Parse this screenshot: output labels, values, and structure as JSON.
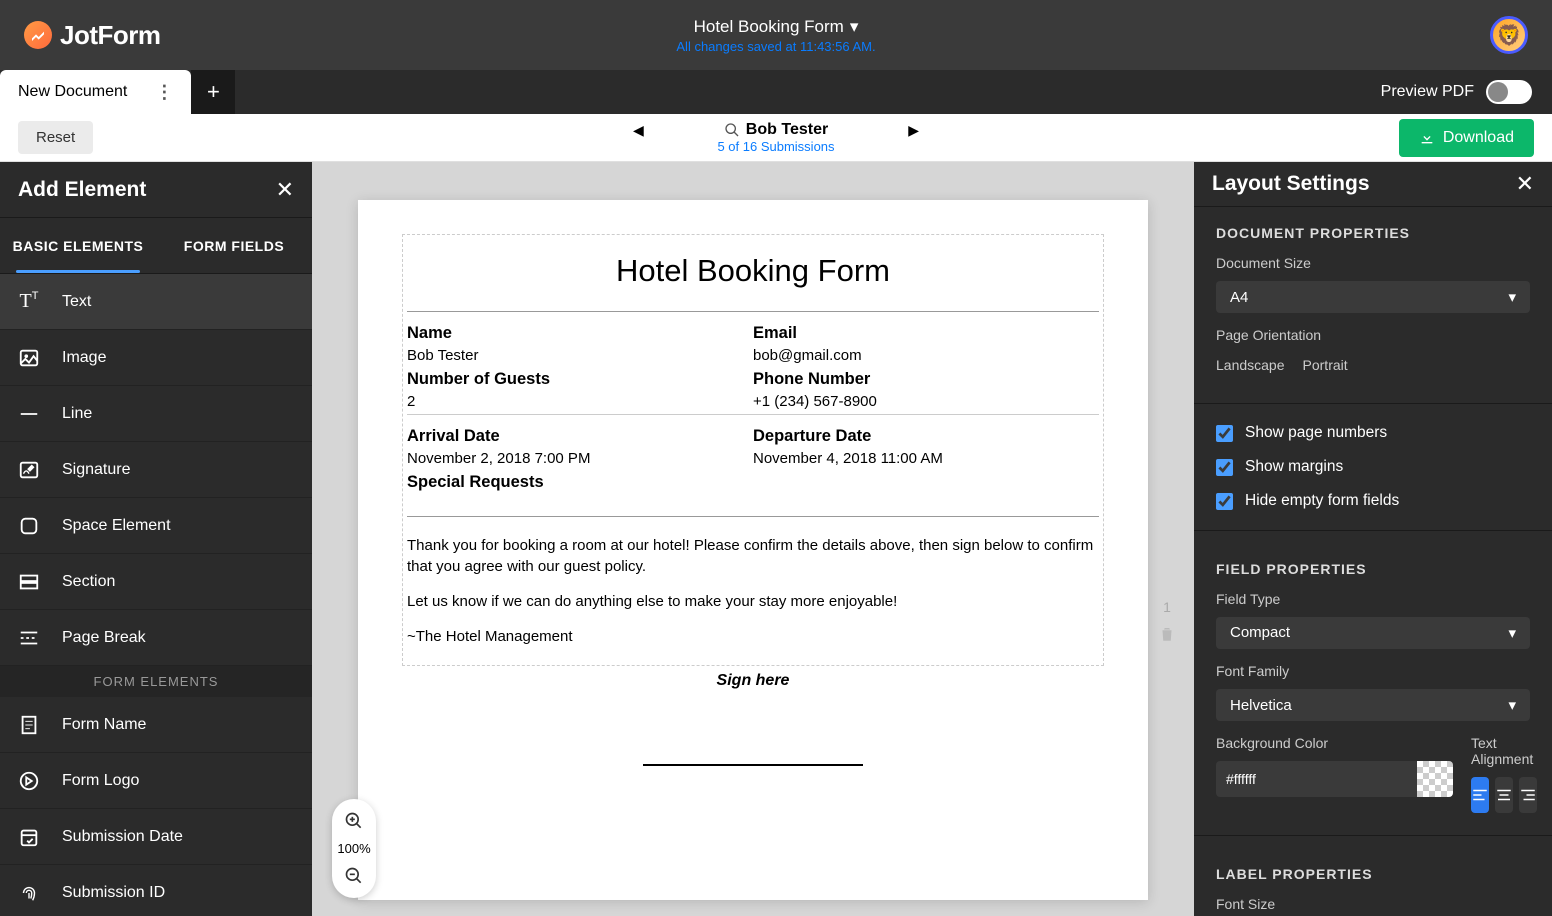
{
  "header": {
    "brand": "JotForm",
    "form_title": "Hotel Booking Form",
    "saved_status": "All changes saved at 11:43:56 AM."
  },
  "secondbar": {
    "tab_label": "New Document",
    "preview_label": "Preview PDF"
  },
  "thirdbar": {
    "reset": "Reset",
    "tester_name": "Bob Tester",
    "submission_count": "5 of 16 Submissions",
    "download": "Download"
  },
  "left_panel": {
    "title": "Add Element",
    "tabs": [
      "BASIC ELEMENTS",
      "FORM FIELDS"
    ],
    "items": [
      "Text",
      "Image",
      "Line",
      "Signature",
      "Space Element",
      "Section",
      "Page Break"
    ],
    "divider": "FORM ELEMENTS",
    "form_items": [
      "Form Name",
      "Form Logo",
      "Submission Date",
      "Submission ID"
    ]
  },
  "document": {
    "title": "Hotel Booking Form",
    "fields": {
      "name_label": "Name",
      "name": "Bob Tester",
      "email_label": "Email",
      "email": "bob@gmail.com",
      "guests_label": "Number of Guests",
      "guests": "2",
      "phone_label": "Phone Number",
      "phone": "+1 (234) 567-8900",
      "arrival_label": "Arrival Date",
      "arrival": "November 2, 2018 7:00 PM",
      "departure_label": "Departure Date",
      "departure": "November 4, 2018 11:00 AM",
      "special_label": "Special Requests"
    },
    "message_p1": "Thank you for booking a room at our hotel! Please confirm the details above, then sign below to confirm that you agree with our guest policy.",
    "message_p2": "Let us know if we can do anything else to make your stay more enjoyable!",
    "message_sig": "~The Hotel Management",
    "sign_here": "Sign here"
  },
  "page_number": "1",
  "zoom": "100%",
  "right_panel": {
    "title": "Layout Settings",
    "doc_props": "DOCUMENT PROPERTIES",
    "doc_size_label": "Document Size",
    "doc_size": "A4",
    "orient_label": "Page Orientation",
    "orient_options": [
      "Landscape",
      "Portrait"
    ],
    "checks": [
      "Show page numbers",
      "Show margins",
      "Hide empty form fields"
    ],
    "field_props": "FIELD PROPERTIES",
    "field_type_label": "Field Type",
    "field_type": "Compact",
    "font_label": "Font Family",
    "font": "Helvetica",
    "bg_label": "Background Color",
    "bg_value": "#ffffff",
    "align_label": "Text Alignment",
    "label_props": "LABEL PROPERTIES",
    "font_size_label": "Font Size"
  }
}
